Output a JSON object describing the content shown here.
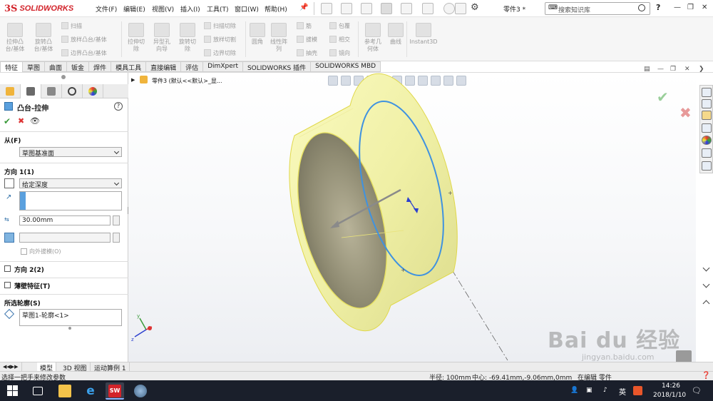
{
  "app": {
    "logo_mark": "3S",
    "logo_text": "SOLIDWORKS",
    "document_title": "零件3 *",
    "search_placeholder": "搜索知识库"
  },
  "menu": [
    "文件(F)",
    "编辑(E)",
    "视图(V)",
    "插入(I)",
    "工具(T)",
    "窗口(W)",
    "帮助(H)"
  ],
  "ribbon": {
    "big": [
      {
        "label": "拉伸凸\n台/基体",
        "icon": "extrude-boss-icon"
      },
      {
        "label": "旋转凸\n台/基体",
        "icon": "revolve-boss-icon"
      },
      {
        "label": "拉伸切\n除",
        "icon": "extrude-cut-icon"
      },
      {
        "label": "异型孔\n向导",
        "icon": "hole-wizard-icon"
      },
      {
        "label": "旋转切\n除",
        "icon": "revolve-cut-icon"
      },
      {
        "label": "圆角",
        "icon": "fillet-icon"
      },
      {
        "label": "线性阵\n列",
        "icon": "linear-pattern-icon"
      },
      {
        "label": "参考几\n何体",
        "icon": "reference-geometry-icon"
      },
      {
        "label": "曲线",
        "icon": "curves-icon"
      },
      {
        "label": "Instant3D",
        "icon": "instant3d-icon"
      }
    ],
    "small": [
      {
        "label": "扫描",
        "icon": "sweep-icon"
      },
      {
        "label": "放样凸台/基体",
        "icon": "loft-icon"
      },
      {
        "label": "边界凸台/基体",
        "icon": "boundary-icon"
      },
      {
        "label": "扫描切除",
        "icon": "swept-cut-icon"
      },
      {
        "label": "放样切割",
        "icon": "lofted-cut-icon"
      },
      {
        "label": "边界切除",
        "icon": "boundary-cut-icon"
      },
      {
        "label": "筋",
        "icon": "rib-icon"
      },
      {
        "label": "拔模",
        "icon": "draft-icon"
      },
      {
        "label": "抽壳",
        "icon": "shell-icon"
      },
      {
        "label": "包覆",
        "icon": "wrap-icon"
      },
      {
        "label": "相交",
        "icon": "intersect-icon"
      },
      {
        "label": "镜向",
        "icon": "mirror-icon"
      }
    ]
  },
  "tabs": [
    "特征",
    "草图",
    "曲面",
    "钣金",
    "焊件",
    "模具工具",
    "直接编辑",
    "评估",
    "DimXpert",
    "SOLIDWORKS 插件",
    "SOLIDWORKS MBD"
  ],
  "active_tab": "特征",
  "feature_tree": {
    "part_label": "零件3 (默认<<默认>_显..."
  },
  "property_manager": {
    "title": "凸台-拉伸",
    "from": {
      "heading": "从(F)",
      "value": "草图基准面"
    },
    "direction1": {
      "heading": "方向 1(1)",
      "end_condition": "给定深度",
      "depth": "30.00mm",
      "draft_outward_label": "向外拔模(O)"
    },
    "direction2": {
      "heading": "方向 2(2)"
    },
    "thin_feature": {
      "heading": "薄壁特征(T)"
    },
    "selected_contours": {
      "heading": "所选轮廓(S)",
      "value": "草图1-轮廓<1>"
    }
  },
  "bottom_tabs": [
    "模型",
    "3D 视图",
    "运动算例 1"
  ],
  "status": {
    "hint": "选择一把手来修改参数",
    "radius": "半径: 100mm",
    "center": "中心: -69.41mm,-9.06mm,0mm",
    "editing": "在编辑 零件"
  },
  "taskbar": {
    "ime": "英",
    "time": "14:26",
    "date": "2018/1/10",
    "sw_badge": "SW"
  },
  "watermark": {
    "text": "Bai du 经验",
    "url": "jingyan.baidu.com"
  },
  "colors": {
    "logo_red": "#d2232a",
    "accept_green": "#3a9a3a",
    "cancel_red": "#d33",
    "cylinder_yellow": "#f4f4a8",
    "edge_blue": "#3f92e0"
  }
}
